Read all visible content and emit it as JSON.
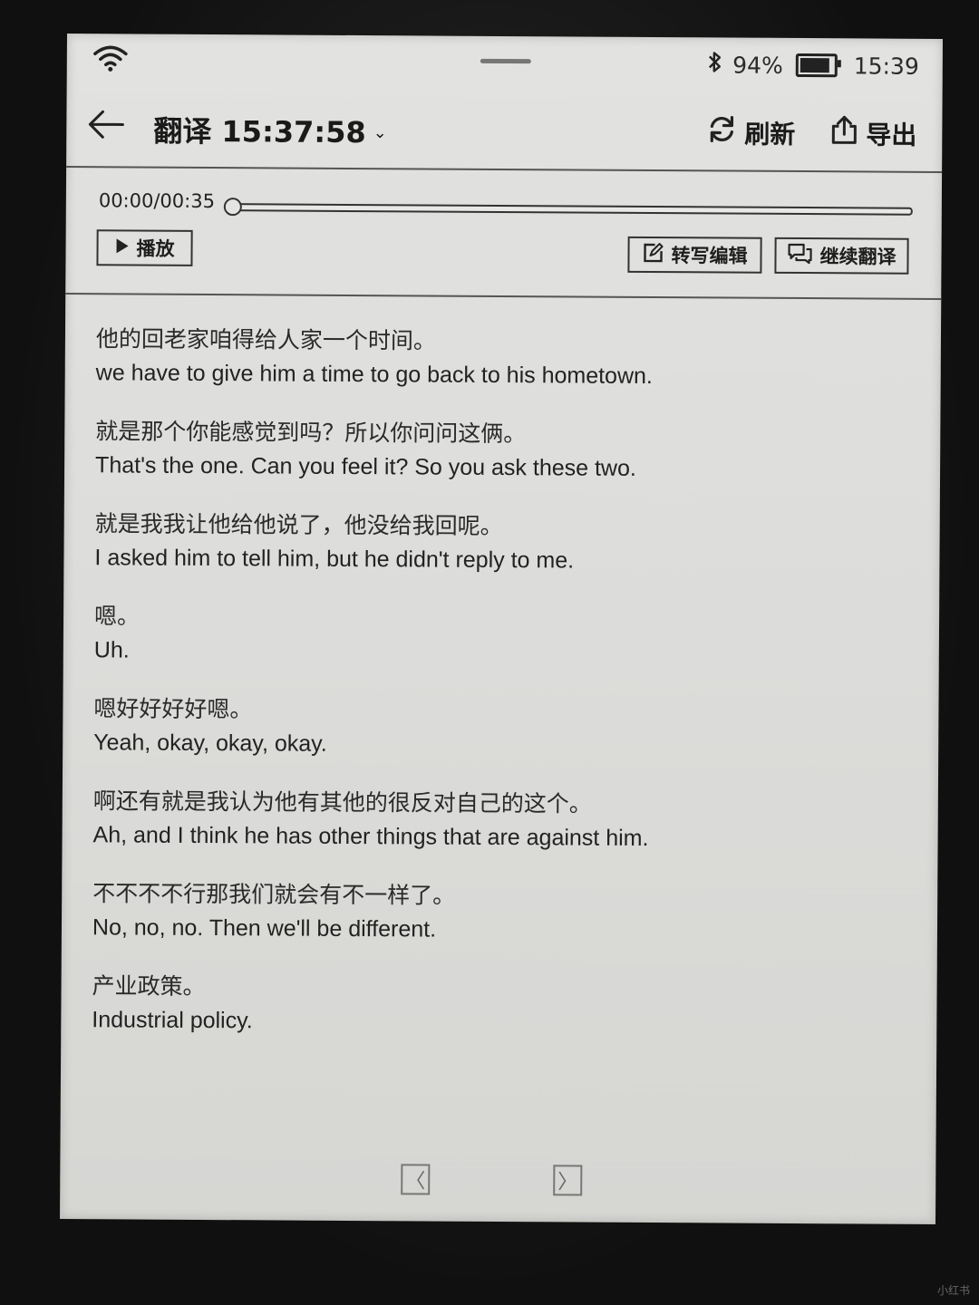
{
  "status_bar": {
    "battery_percent": "94%",
    "battery_level": 0.94,
    "time": "15:39",
    "icons": [
      "wifi-icon",
      "bluetooth-icon",
      "battery-icon"
    ]
  },
  "header": {
    "title": "翻译 15:37:58",
    "refresh_label": "刷新",
    "export_label": "导出",
    "icons": [
      "back-arrow-icon",
      "chevron-down-icon",
      "refresh-icon",
      "export-icon"
    ]
  },
  "player": {
    "time": "00:00/00:35",
    "progress": 0,
    "play_label": "播放",
    "transcript_edit_label": "转写编辑",
    "continue_translate_label": "继续翻译",
    "icons": [
      "play-icon",
      "edit-icon",
      "chat-icon"
    ]
  },
  "transcript": [
    {
      "zh": "他的回老家咱得给人家一个时间。",
      "en": "we have to give him a time to go back to his hometown."
    },
    {
      "zh": "就是那个你能感觉到吗？所以你问问这俩。",
      "en": "That's the one. Can you feel it? So you ask these two."
    },
    {
      "zh": "就是我我让他给他说了，他没给我回呢。",
      "en": "I asked him to tell him, but he didn't reply to me."
    },
    {
      "zh": "嗯。",
      "en": "Uh."
    },
    {
      "zh": "嗯好好好好嗯。",
      "en": "Yeah, okay, okay, okay."
    },
    {
      "zh": "啊还有就是我认为他有其他的很反对自己的这个。",
      "en": "Ah, and I think he has other things that are against him."
    },
    {
      "zh": "不不不不行那我们就会有不一样了。",
      "en": "No, no, no. Then we'll be different."
    },
    {
      "zh": "产业政策。",
      "en": "Industrial policy."
    }
  ],
  "pager": {
    "prev_glyph": "〈",
    "next_glyph": "〉"
  },
  "watermark": "小红书"
}
